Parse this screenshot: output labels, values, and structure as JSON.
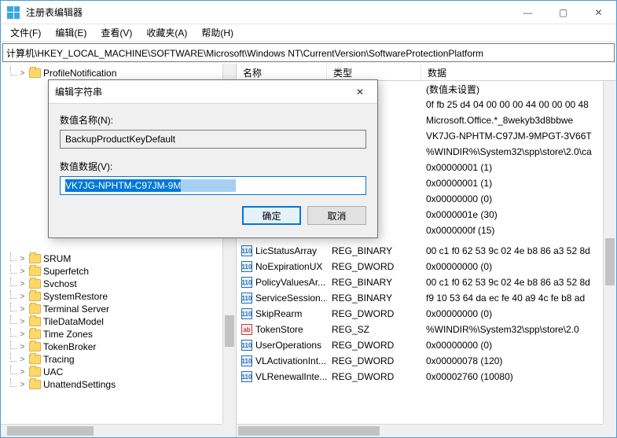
{
  "title": "注册表编辑器",
  "window_controls": {
    "min": "—",
    "max": "▢",
    "close": "✕"
  },
  "menu": [
    "文件(F)",
    "编辑(E)",
    "查看(V)",
    "收藏夹(A)",
    "帮助(H)"
  ],
  "address": "计算机\\HKEY_LOCAL_MACHINE\\SOFTWARE\\Microsoft\\Windows NT\\CurrentVersion\\SoftwareProtectionPlatform",
  "tree": {
    "upper": [
      {
        "label": "ProfileNotification",
        "expander": ">"
      }
    ],
    "lower": [
      {
        "label": "SRUM"
      },
      {
        "label": "Superfetch"
      },
      {
        "label": "Svchost"
      },
      {
        "label": "SystemRestore"
      },
      {
        "label": "Terminal Server"
      },
      {
        "label": "TileDataModel"
      },
      {
        "label": "Time Zones"
      },
      {
        "label": "TokenBroker"
      },
      {
        "label": "Tracing"
      },
      {
        "label": "UAC"
      },
      {
        "label": "UnattendSettings"
      }
    ]
  },
  "list": {
    "columns": {
      "name": "名称",
      "type": "类型",
      "data": "数据"
    },
    "upper": [
      {
        "icon": "sz",
        "name": "",
        "type": "",
        "data": "(数值未设置)"
      },
      {
        "icon": "bin",
        "name": "",
        "type": "",
        "data": "0f fb 25 d4 04 00 00 00 44 00 00 00 48"
      },
      {
        "icon": "sz",
        "name": "",
        "type": "",
        "data": "Microsoft.Office.*_8wekyb3d8bbwe"
      },
      {
        "icon": "sz",
        "name": "",
        "type": "",
        "data": "VK7JG-NPHTM-C97JM-9MPGT-3V66T"
      },
      {
        "icon": "sz",
        "name": "",
        "type": "",
        "data": "%WINDIR%\\System32\\spp\\store\\2.0\\ca"
      },
      {
        "icon": "bin",
        "name": "",
        "type": "",
        "data": "0x00000001 (1)"
      },
      {
        "icon": "bin",
        "name": "",
        "type": "",
        "data": "0x00000001 (1)"
      },
      {
        "icon": "bin",
        "name": "",
        "type": "",
        "data": "0x00000000 (0)"
      },
      {
        "icon": "bin",
        "name": "",
        "type": "",
        "data": "0x0000001e (30)"
      },
      {
        "icon": "bin",
        "name": "",
        "type": "",
        "data": "0x0000000f (15)"
      }
    ],
    "lower": [
      {
        "icon": "bin",
        "name": "LicStatusArray",
        "type": "REG_BINARY",
        "data": "00 c1 f0 62 53 9c 02 4e b8 86 a3 52 8d"
      },
      {
        "icon": "bin",
        "name": "NoExpirationUX",
        "type": "REG_DWORD",
        "data": "0x00000000 (0)"
      },
      {
        "icon": "bin",
        "name": "PolicyValuesAr...",
        "type": "REG_BINARY",
        "data": "00 c1 f0 62 53 9c 02 4e b8 86 a3 52 8d"
      },
      {
        "icon": "bin",
        "name": "ServiceSession...",
        "type": "REG_BINARY",
        "data": "f9 10 53 64 da ec fe 40 a9 4c fe b8 ad"
      },
      {
        "icon": "bin",
        "name": "SkipRearm",
        "type": "REG_DWORD",
        "data": "0x00000000 (0)"
      },
      {
        "icon": "sz",
        "name": "TokenStore",
        "type": "REG_SZ",
        "data": "%WINDIR%\\System32\\spp\\store\\2.0"
      },
      {
        "icon": "bin",
        "name": "UserOperations",
        "type": "REG_DWORD",
        "data": "0x00000000 (0)"
      },
      {
        "icon": "bin",
        "name": "VLActivationInt...",
        "type": "REG_DWORD",
        "data": "0x00000078 (120)"
      },
      {
        "icon": "bin",
        "name": "VLRenewalInte...",
        "type": "REG_DWORD",
        "data": "0x00002760 (10080)"
      }
    ]
  },
  "dialog": {
    "title": "编辑字符串",
    "name_label": "数值名称(N):",
    "name_value": "BackupProductKeyDefault",
    "data_label": "数值数据(V):",
    "data_value": "VK7JG-NPHTM-C97JM-9M",
    "ok": "确定",
    "cancel": "取消",
    "close": "✕"
  }
}
